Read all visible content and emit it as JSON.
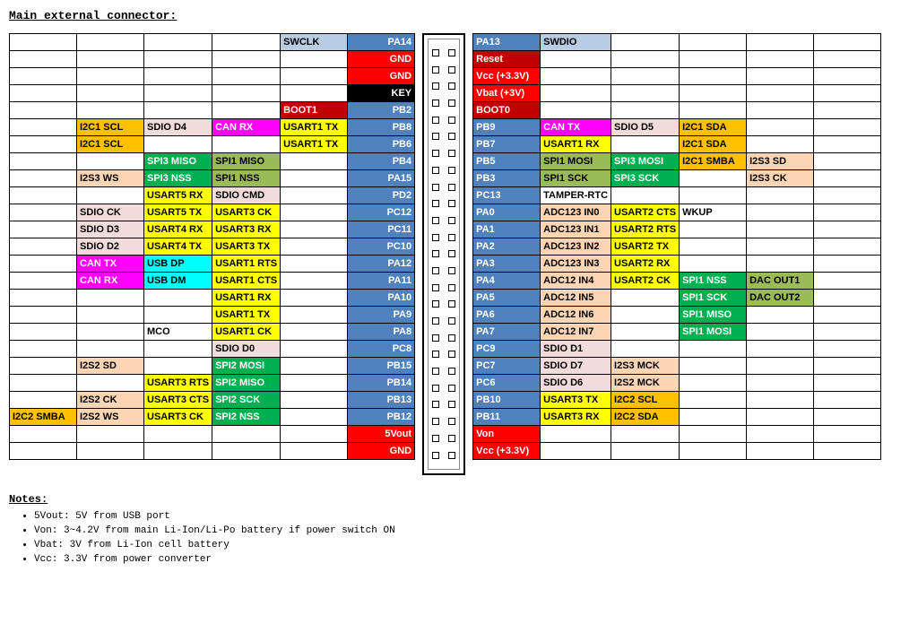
{
  "title": "Main external connector:",
  "notes_title": "Notes:",
  "notes": [
    "5Vout: 5V from USB port",
    "Von:   3~4.2V from main Li-Ion/Li-Po battery if power switch ON",
    "Vbat:  3V from Li-Ion cell battery",
    "Vcc:   3.3V from power converter"
  ],
  "left": [
    [
      null,
      null,
      null,
      null,
      {
        "t": "SWCLK",
        "c": "lblue"
      },
      {
        "t": "PA14",
        "c": "blue"
      }
    ],
    [
      null,
      null,
      null,
      null,
      null,
      {
        "t": "GND",
        "c": "red"
      }
    ],
    [
      null,
      null,
      null,
      null,
      null,
      {
        "t": "GND",
        "c": "red"
      }
    ],
    [
      null,
      null,
      null,
      null,
      null,
      {
        "t": "KEY",
        "c": "black"
      }
    ],
    [
      null,
      null,
      null,
      null,
      {
        "t": "BOOT1",
        "c": "dred"
      },
      {
        "t": "PB2",
        "c": "blue"
      }
    ],
    [
      null,
      {
        "t": "I2C1 SCL",
        "c": "orange"
      },
      {
        "t": "SDIO D4",
        "c": "pink"
      },
      {
        "t": "CAN RX",
        "c": "magenta"
      },
      {
        "t": "USART1 TX",
        "c": "yellow"
      },
      {
        "t": "PB8",
        "c": "blue"
      }
    ],
    [
      null,
      {
        "t": "I2C1 SCL",
        "c": "orange"
      },
      null,
      null,
      {
        "t": "USART1 TX",
        "c": "yellow"
      },
      {
        "t": "PB6",
        "c": "blue"
      }
    ],
    [
      null,
      null,
      {
        "t": "SPI3 MISO",
        "c": "green"
      },
      {
        "t": "SPI1 MISO",
        "c": "dgreen"
      },
      null,
      {
        "t": "PB4",
        "c": "blue"
      }
    ],
    [
      null,
      {
        "t": "I2S3 WS",
        "c": "tan"
      },
      {
        "t": "SPI3 NSS",
        "c": "green"
      },
      {
        "t": "SPI1 NSS",
        "c": "dgreen"
      },
      null,
      {
        "t": "PA15",
        "c": "blue"
      }
    ],
    [
      null,
      null,
      {
        "t": "USART5 RX",
        "c": "yellow"
      },
      {
        "t": "SDIO CMD",
        "c": "pink"
      },
      null,
      {
        "t": "PD2",
        "c": "blue"
      }
    ],
    [
      null,
      {
        "t": "SDIO CK",
        "c": "pink"
      },
      {
        "t": "USART5 TX",
        "c": "yellow"
      },
      {
        "t": "USART3 CK",
        "c": "yellow"
      },
      null,
      {
        "t": "PC12",
        "c": "blue"
      }
    ],
    [
      null,
      {
        "t": "SDIO D3",
        "c": "pink"
      },
      {
        "t": "USART4 RX",
        "c": "yellow"
      },
      {
        "t": "USART3 RX",
        "c": "yellow"
      },
      null,
      {
        "t": "PC11",
        "c": "blue"
      }
    ],
    [
      null,
      {
        "t": "SDIO D2",
        "c": "pink"
      },
      {
        "t": "USART4 TX",
        "c": "yellow"
      },
      {
        "t": "USART3 TX",
        "c": "yellow"
      },
      null,
      {
        "t": "PC10",
        "c": "blue"
      }
    ],
    [
      null,
      {
        "t": "CAN TX",
        "c": "magenta"
      },
      {
        "t": "USB DP",
        "c": "cyan"
      },
      {
        "t": "USART1 RTS",
        "c": "yellow"
      },
      null,
      {
        "t": "PA12",
        "c": "blue"
      }
    ],
    [
      null,
      {
        "t": "CAN RX",
        "c": "magenta"
      },
      {
        "t": "USB DM",
        "c": "cyan"
      },
      {
        "t": "USART1 CTS",
        "c": "yellow"
      },
      null,
      {
        "t": "PA11",
        "c": "blue"
      }
    ],
    [
      null,
      null,
      null,
      {
        "t": "USART1 RX",
        "c": "yellow"
      },
      null,
      {
        "t": "PA10",
        "c": "blue"
      }
    ],
    [
      null,
      null,
      null,
      {
        "t": "USART1 TX",
        "c": "yellow"
      },
      null,
      {
        "t": "PA9",
        "c": "blue"
      }
    ],
    [
      null,
      null,
      {
        "t": "MCO",
        "c": ""
      },
      {
        "t": "USART1 CK",
        "c": "yellow"
      },
      null,
      {
        "t": "PA8",
        "c": "blue"
      }
    ],
    [
      null,
      null,
      null,
      {
        "t": "SDIO D0",
        "c": "pink"
      },
      null,
      {
        "t": "PC8",
        "c": "blue"
      }
    ],
    [
      null,
      {
        "t": "I2S2 SD",
        "c": "tan"
      },
      null,
      {
        "t": "SPI2 MOSI",
        "c": "green"
      },
      null,
      {
        "t": "PB15",
        "c": "blue"
      }
    ],
    [
      null,
      null,
      {
        "t": "USART3 RTS",
        "c": "yellow"
      },
      {
        "t": "SPI2 MISO",
        "c": "green"
      },
      null,
      {
        "t": "PB14",
        "c": "blue"
      }
    ],
    [
      null,
      {
        "t": "I2S2 CK",
        "c": "tan"
      },
      {
        "t": "USART3 CTS",
        "c": "yellow"
      },
      {
        "t": "SPI2 SCK",
        "c": "green"
      },
      null,
      {
        "t": "PB13",
        "c": "blue"
      }
    ],
    [
      {
        "t": "I2C2 SMBA",
        "c": "orange"
      },
      {
        "t": "I2S2 WS",
        "c": "tan"
      },
      {
        "t": "USART3 CK",
        "c": "yellow"
      },
      {
        "t": "SPI2 NSS",
        "c": "green"
      },
      null,
      {
        "t": "PB12",
        "c": "blue"
      }
    ],
    [
      null,
      null,
      null,
      null,
      null,
      {
        "t": "5Vout",
        "c": "red"
      }
    ],
    [
      null,
      null,
      null,
      null,
      null,
      {
        "t": "GND",
        "c": "red"
      }
    ]
  ],
  "right": [
    [
      {
        "t": "PA13",
        "c": "blue"
      },
      {
        "t": "SWDIO",
        "c": "lblue"
      },
      null,
      null,
      null,
      null
    ],
    [
      {
        "t": "Reset",
        "c": "dred"
      },
      null,
      null,
      null,
      null,
      null
    ],
    [
      {
        "t": "Vcc (+3.3V)",
        "c": "red"
      },
      null,
      null,
      null,
      null,
      null
    ],
    [
      {
        "t": "Vbat (+3V)",
        "c": "red"
      },
      null,
      null,
      null,
      null,
      null
    ],
    [
      {
        "t": "BOOT0",
        "c": "dred"
      },
      null,
      null,
      null,
      null,
      null
    ],
    [
      {
        "t": "PB9",
        "c": "blue"
      },
      {
        "t": "CAN TX",
        "c": "magenta"
      },
      {
        "t": "SDIO D5",
        "c": "pink"
      },
      {
        "t": "I2C1 SDA",
        "c": "orange"
      },
      null,
      null
    ],
    [
      {
        "t": "PB7",
        "c": "blue"
      },
      {
        "t": "USART1 RX",
        "c": "yellow"
      },
      null,
      {
        "t": "I2C1 SDA",
        "c": "orange"
      },
      null,
      null
    ],
    [
      {
        "t": "PB5",
        "c": "blue"
      },
      {
        "t": "SPI1 MOSI",
        "c": "dgreen"
      },
      {
        "t": "SPI3 MOSI",
        "c": "green"
      },
      {
        "t": "I2C1 SMBA",
        "c": "orange"
      },
      {
        "t": "I2S3 SD",
        "c": "tan"
      },
      null
    ],
    [
      {
        "t": "PB3",
        "c": "blue"
      },
      {
        "t": "SPI1 SCK",
        "c": "dgreen"
      },
      {
        "t": "SPI3 SCK",
        "c": "green"
      },
      null,
      {
        "t": "I2S3 CK",
        "c": "tan"
      },
      null
    ],
    [
      {
        "t": "PC13",
        "c": "blue"
      },
      {
        "t": "TAMPER-RTC",
        "c": ""
      },
      null,
      null,
      null,
      null
    ],
    [
      {
        "t": "PA0",
        "c": "blue"
      },
      {
        "t": "ADC123 IN0",
        "c": "tan"
      },
      {
        "t": "USART2 CTS",
        "c": "yellow"
      },
      {
        "t": "WKUP",
        "c": ""
      },
      null,
      null
    ],
    [
      {
        "t": "PA1",
        "c": "blue"
      },
      {
        "t": "ADC123 IN1",
        "c": "tan"
      },
      {
        "t": "USART2 RTS",
        "c": "yellow"
      },
      null,
      null,
      null
    ],
    [
      {
        "t": "PA2",
        "c": "blue"
      },
      {
        "t": "ADC123 IN2",
        "c": "tan"
      },
      {
        "t": "USART2 TX",
        "c": "yellow"
      },
      null,
      null,
      null
    ],
    [
      {
        "t": "PA3",
        "c": "blue"
      },
      {
        "t": "ADC123 IN3",
        "c": "tan"
      },
      {
        "t": "USART2 RX",
        "c": "yellow"
      },
      null,
      null,
      null
    ],
    [
      {
        "t": "PA4",
        "c": "blue"
      },
      {
        "t": "ADC12 IN4",
        "c": "tan"
      },
      {
        "t": "USART2 CK",
        "c": "yellow"
      },
      {
        "t": "SPI1 NSS",
        "c": "green"
      },
      {
        "t": "DAC OUT1",
        "c": "dgreen"
      },
      null
    ],
    [
      {
        "t": "PA5",
        "c": "blue"
      },
      {
        "t": "ADC12 IN5",
        "c": "tan"
      },
      null,
      {
        "t": "SPI1 SCK",
        "c": "green"
      },
      {
        "t": "DAC OUT2",
        "c": "dgreen"
      },
      null
    ],
    [
      {
        "t": "PA6",
        "c": "blue"
      },
      {
        "t": "ADC12 IN6",
        "c": "tan"
      },
      null,
      {
        "t": "SPI1 MISO",
        "c": "green"
      },
      null,
      null
    ],
    [
      {
        "t": "PA7",
        "c": "blue"
      },
      {
        "t": "ADC12 IN7",
        "c": "tan"
      },
      null,
      {
        "t": "SPI1 MOSI",
        "c": "green"
      },
      null,
      null
    ],
    [
      {
        "t": "PC9",
        "c": "blue"
      },
      {
        "t": "SDIO D1",
        "c": "pink"
      },
      null,
      null,
      null,
      null
    ],
    [
      {
        "t": "PC7",
        "c": "blue"
      },
      {
        "t": "SDIO D7",
        "c": "pink"
      },
      {
        "t": "I2S3 MCK",
        "c": "tan"
      },
      null,
      null,
      null
    ],
    [
      {
        "t": "PC6",
        "c": "blue"
      },
      {
        "t": "SDIO D6",
        "c": "pink"
      },
      {
        "t": "I2S2 MCK",
        "c": "tan"
      },
      null,
      null,
      null
    ],
    [
      {
        "t": "PB10",
        "c": "blue"
      },
      {
        "t": "USART3 TX",
        "c": "yellow"
      },
      {
        "t": "I2C2 SCL",
        "c": "orange"
      },
      null,
      null,
      null
    ],
    [
      {
        "t": "PB11",
        "c": "blue"
      },
      {
        "t": "USART3 RX",
        "c": "yellow"
      },
      {
        "t": "I2C2 SDA",
        "c": "orange"
      },
      null,
      null,
      null
    ],
    [
      {
        "t": "Von",
        "c": "red"
      },
      null,
      null,
      null,
      null,
      null
    ],
    [
      {
        "t": "Vcc (+3.3V)",
        "c": "red"
      },
      null,
      null,
      null,
      null,
      null
    ]
  ],
  "conn_rows": 25
}
